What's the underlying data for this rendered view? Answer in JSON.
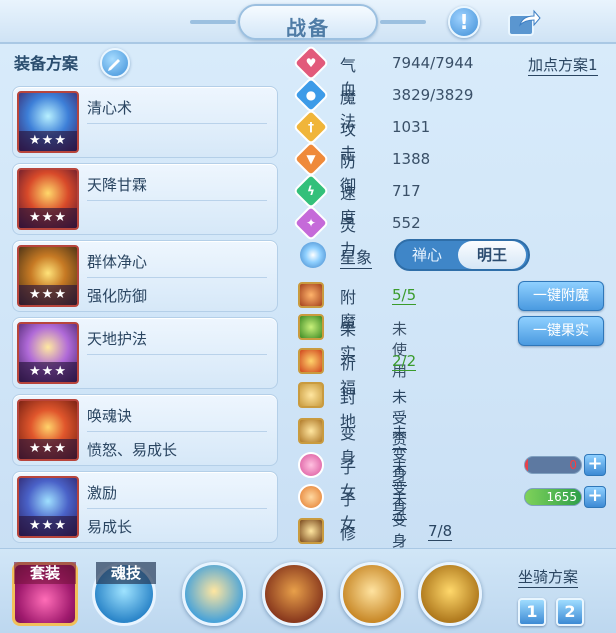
{
  "header": {
    "title": "战备"
  },
  "left": {
    "scheme_title": "装备方案",
    "slots": [
      {
        "line1": "清心术",
        "line2": "",
        "stars": "★★★"
      },
      {
        "line1": "天降甘霖",
        "line2": "",
        "stars": "★★★"
      },
      {
        "line1": "群体净心",
        "line2": "强化防御",
        "stars": "★★★"
      },
      {
        "line1": "天地护法",
        "line2": "",
        "stars": "★★★"
      },
      {
        "line1": "唤魂诀",
        "line2": "愤怒、易成长",
        "stars": "★★★"
      },
      {
        "line1": "激励",
        "line2": "易成长",
        "stars": "★★★"
      }
    ]
  },
  "stats": {
    "plan_link": "加点方案1",
    "items": [
      {
        "label": "气血",
        "value": "7944/7944",
        "icon": "heart-icon",
        "color": "#e25a7b"
      },
      {
        "label": "魔法",
        "value": "3829/3829",
        "icon": "mana-icon",
        "color": "#3d9be8"
      },
      {
        "label": "攻击",
        "value": "1031",
        "icon": "sword-icon",
        "color": "#f0b53a"
      },
      {
        "label": "防御",
        "value": "1388",
        "icon": "shield-icon",
        "color": "#ef8a3a"
      },
      {
        "label": "速度",
        "value": "717",
        "icon": "lightning-icon",
        "color": "#33c07a"
      },
      {
        "label": "灵力",
        "value": "552",
        "icon": "spirit-icon",
        "color": "#c56ad9"
      }
    ],
    "xingxiang": {
      "label": "星象",
      "opt_left": "禅心",
      "opt_right": "明王"
    }
  },
  "extra": {
    "fumo": {
      "label": "附魔",
      "value": "5/5",
      "button": "一键附魔"
    },
    "guoshi": {
      "label": "果实",
      "value": "未使用",
      "button": "一键果实"
    },
    "qifu": {
      "label": "祈福",
      "value": "2/2"
    },
    "fengdi": {
      "label": "封地",
      "value": "未受赏"
    },
    "bianshen": {
      "label": "变身",
      "value": "未变身"
    },
    "zinv1": {
      "label": "子女",
      "value": "未变身",
      "bar_value": "0"
    },
    "zinv2": {
      "label": "子女",
      "value": "未变身",
      "bar_value": "1655"
    },
    "xiulian": {
      "label": "修炼觉醒",
      "value": "7/8"
    }
  },
  "bottom": {
    "suit_label": "套装",
    "soul_label": "魂技",
    "mount_label": "坐骑方案",
    "mount_buttons": [
      "1",
      "2"
    ]
  },
  "colors": {
    "accent": "#3d8ad4",
    "green_value": "#3a9b2c",
    "bar_fill_red": "#e8424a",
    "bar_fill_green": "#7fd25a"
  }
}
